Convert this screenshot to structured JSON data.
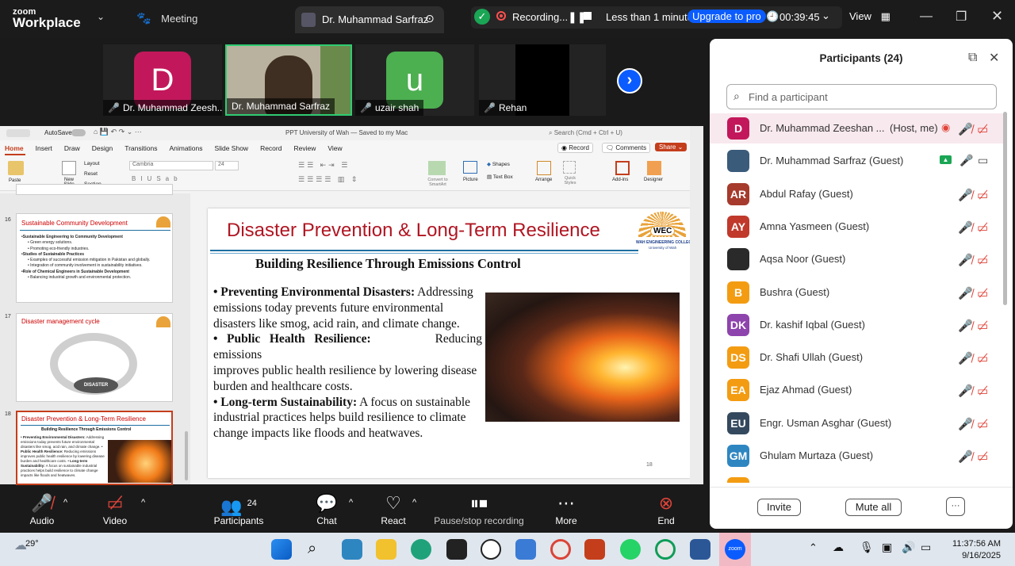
{
  "app": {
    "brand_small": "zoom",
    "brand_large": "Workplace",
    "meeting_tab": "Meeting",
    "share_tab": "Dr. Muhammad Sarfraz"
  },
  "recording": {
    "label": "Recording...",
    "time_left": "Less than 1 minute",
    "upgrade": "Upgrade to pro",
    "timer": "00:39:45",
    "view": "View"
  },
  "video_tiles": [
    {
      "initial": "D",
      "color": "#c2185b",
      "name": "Dr. Muhammad Zeesh..."
    },
    {
      "initial": "",
      "color": "#8a7a60",
      "name": "Dr. Muhammad Sarfraz"
    },
    {
      "initial": "u",
      "color": "#4caf50",
      "name": "uzair shah"
    },
    {
      "initial": "",
      "color": "#000000",
      "name": "Rehan"
    }
  ],
  "ppt": {
    "autosave": "AutoSave",
    "doc_title": "PPT University of Wah — Saved to my Mac",
    "search": "Search (Cmd + Ctrl + U)",
    "tabs": [
      "Home",
      "Insert",
      "Draw",
      "Design",
      "Transitions",
      "Animations",
      "Slide Show",
      "Record",
      "Review",
      "View"
    ],
    "record_btn": "Record",
    "comments_btn": "Comments",
    "share_btn": "Share",
    "font": "Cambria",
    "font_size": "24",
    "tools": [
      "Paste",
      "New Slide",
      "Layout",
      "Reset",
      "Section",
      "Convert to SmartArt",
      "Picture",
      "Shapes",
      "Text Box",
      "Arrange",
      "Quick Styles",
      "Add-ins",
      "Designer"
    ],
    "thumbs": [
      {
        "num": "16",
        "title": "Sustainable Community Development"
      },
      {
        "num": "17",
        "title": "Disaster management cycle"
      },
      {
        "num": "18",
        "title": "Disaster Prevention & Long-Term Resilience"
      }
    ],
    "thumb16_lines": [
      "•Sustainable Engineering to Community Development",
      "• Green energy solutions.",
      "• Promoting eco-friendly industries.",
      "•Studies of Sustainable Practices",
      "• Examples of successful emission mitigation in Pakistan and globally.",
      "• Integration of community involvement in sustainability initiatives.",
      "•Role of Chemical Engineers in Sustainable Development",
      "• Balancing industrial growth and environmental protection."
    ],
    "thumb17_center": "DISASTER",
    "slide": {
      "title": "Disaster Prevention & Long-Term Resilience",
      "logo_text": "WEC",
      "logo_sub": "WAH ENGINEERING COLLEGE",
      "logo_sub2": "University of Wah",
      "subtitle": "Building Resilience Through Emissions Control",
      "b1_head": "• Preventing Environmental Disasters:",
      "b1_text": "Addressing emissions today prevents future environmental disasters like smog, acid rain, and climate change.",
      "b2_head": "•   Public   Health   Resilience:",
      "b2_tail": "Reducing",
      "b2_text1": "emissions",
      "b2_text2": "improves public health resilience by lowering disease burden and healthcare costs.",
      "b3_head": "• Long-term Sustainability:",
      "b3_text": "A focus on sustainable industrial practices helps build resilience to climate change impacts like floods and heatwaves.",
      "page_num": "18"
    }
  },
  "bottombar": [
    {
      "label": "Audio"
    },
    {
      "label": "Video"
    },
    {
      "label": "Participants",
      "count": "24"
    },
    {
      "label": "Chat"
    },
    {
      "label": "React"
    },
    {
      "label": "Pause/stop recording"
    },
    {
      "label": "More"
    },
    {
      "label": "End"
    }
  ],
  "participants": {
    "title": "Participants (24)",
    "search_placeholder": "Find a participant",
    "list": [
      {
        "initials": "D",
        "color": "#c2185b",
        "name": "Dr. Muhammad Zeeshan ...",
        "role": "(Host, me)"
      },
      {
        "initials": "",
        "color": "#3b5b7a",
        "name": "Dr. Muhammad Sarfraz (Guest)"
      },
      {
        "initials": "AR",
        "color": "#a63a2c",
        "name": "Abdul Rafay (Guest)"
      },
      {
        "initials": "AY",
        "color": "#c0392b",
        "name": "Amna Yasmeen (Guest)"
      },
      {
        "initials": "",
        "color": "#2a2a2a",
        "name": "Aqsa Noor (Guest)"
      },
      {
        "initials": "B",
        "color": "#f39c12",
        "name": "Bushra (Guest)"
      },
      {
        "initials": "DK",
        "color": "#8e44ad",
        "name": "Dr. kashif Iqbal (Guest)"
      },
      {
        "initials": "DS",
        "color": "#f39c12",
        "name": "Dr. Shafi Ullah (Guest)"
      },
      {
        "initials": "EA",
        "color": "#f39c12",
        "name": "Ejaz Ahmad (Guest)"
      },
      {
        "initials": "EU",
        "color": "#34495e",
        "name": "Engr. Usman Asghar (Guest)"
      },
      {
        "initials": "GM",
        "color": "#2e86c1",
        "name": "Ghulam Murtaza (Guest)"
      }
    ],
    "invite": "Invite",
    "mute_all": "Mute all",
    "more": "···"
  },
  "taskbar": {
    "weather": "29°",
    "time": "11:37:56 AM",
    "date": "9/16/2025"
  }
}
